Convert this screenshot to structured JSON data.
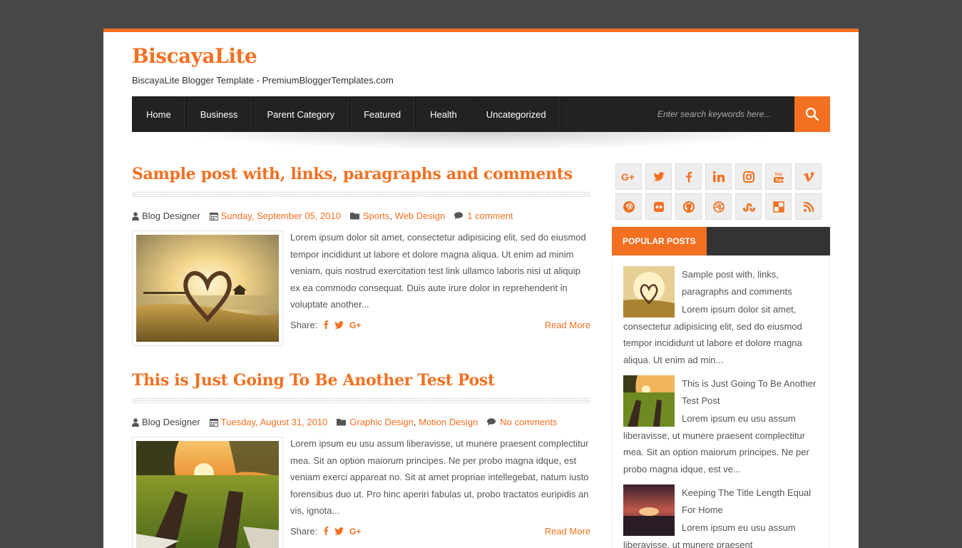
{
  "site": {
    "title": "BiscayaLite",
    "description": "BiscayaLite Blogger Template - PremiumBloggerTemplates.com"
  },
  "nav": {
    "items": [
      "Home",
      "Business",
      "Parent Category",
      "Featured",
      "Health",
      "Uncategorized"
    ],
    "search_placeholder": "Enter search keywords here..."
  },
  "posts": [
    {
      "title": "Sample post with, links, paragraphs and comments",
      "author": "Blog Designer",
      "date": "Sunday, September 05, 2010",
      "label1": "Sports",
      "sep": ",",
      "label2": "Web Design",
      "comments": "1 comment",
      "excerpt": "Lorem ipsum dolor sit amet, consectetur adipisicing elit, sed do eiusmod tempor incididunt ut labore et dolore magna aliqua. Ut enim ad minim veniam, quis nostrud exercitation test link ullamco laboris nisi ut aliquip ex ea commodo consequat. Duis aute irure dolor in reprehenderit in voluptate another...",
      "share_label": "Share:",
      "read_more": "Read More"
    },
    {
      "title": "This is Just Going To Be Another Test Post",
      "author": "Blog Designer",
      "date": "Tuesday, August 31, 2010",
      "label1": "Graphic Design",
      "sep": ",",
      "label2": "Motion Design",
      "comments": "No comments",
      "excerpt": "Lorem ipsum eu usu assum liberavisse, ut munere praesent complectitur mea. Sit an option maiorum principes. Ne per probo magna idque, est veniam exerci appareat no. Sit at amet propriae intellegebat, natum iusto forensibus duo ut. Pro hinc aperiri fabulas ut, probo tractatos euripidis an vis, ignota...",
      "share_label": "Share:",
      "read_more": "Read More"
    }
  ],
  "social_icons": [
    "google-plus-icon",
    "twitter-icon",
    "facebook-icon",
    "linkedin-icon",
    "instagram-icon",
    "youtube-icon",
    "vimeo-icon",
    "pinterest-icon",
    "flickr-icon",
    "github-icon",
    "dribbble-icon",
    "stumbleupon-icon",
    "delicious-icon",
    "rss-icon"
  ],
  "popular": {
    "heading": "POPULAR POSTS",
    "items": [
      {
        "title": "Sample post with, links, paragraphs and comments",
        "excerpt": "Lorem ipsum dolor sit amet, consectetur adipisicing elit, sed do eiusmod tempor incididunt ut labore et dolore magna aliqua. Ut enim ad min..."
      },
      {
        "title": "This is Just Going To Be Another Test Post",
        "excerpt": "Lorem ipsum eu usu assum liberavisse, ut munere praesent complectitur mea. Sit an option maiorum principes. Ne per probo magna idque, est ve..."
      },
      {
        "title": "Keeping The Title Length Equal For Home",
        "excerpt": "Lorem ipsum eu usu assum liberavisse, ut munere praesent"
      }
    ]
  },
  "colors": {
    "accent": "#f37021",
    "nav_bg": "#222222",
    "page_bg": "#474747"
  }
}
